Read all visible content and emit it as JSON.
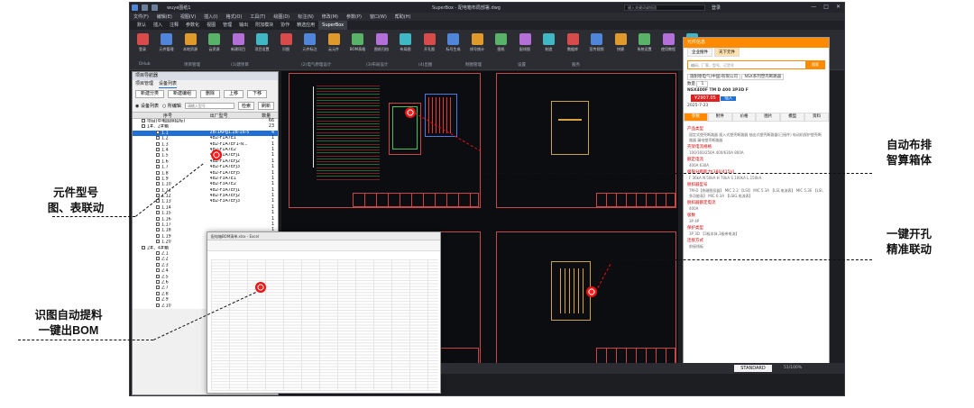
{
  "window": {
    "app_title": "SuperBox - 配电箱布局部署.dwg",
    "doc_name": "wuye图纸1",
    "search_placeholder": "键入关键词或短语",
    "user": "登录",
    "min": "—",
    "max": "□",
    "close": "✕"
  },
  "menu": [
    "文件(F)",
    "编辑(E)",
    "视图(V)",
    "插入(I)",
    "格式(O)",
    "工具(T)",
    "绘图(D)",
    "标注(N)",
    "修改(M)",
    "参数(P)",
    "窗口(W)",
    "帮助(H)"
  ],
  "tabs": [
    "默认",
    "插入",
    "注释",
    "参数化",
    "视图",
    "管理",
    "输出",
    "附加模块",
    "协作",
    "精选应用",
    "SuperBox"
  ],
  "active_tab": "SuperBox",
  "ribbon": {
    "buttons": [
      "登录",
      "元件管理",
      "本地资源",
      "云资源",
      "新建项目",
      "项目设置",
      "识图",
      "元件标注",
      "云元件",
      "BOM表格",
      "图纸归档",
      "布局图",
      "开孔图",
      "标号生成",
      "线号统计",
      "图纸",
      "配线图",
      "制造",
      "数据库",
      "宣传视频",
      "快捷",
      "系统设置",
      "使用教程",
      "在线客服"
    ],
    "groups": [
      "DHub",
      "项目管理",
      "(1)建项目",
      "(2)电气原理设计",
      "(3)布局设计",
      "(4)出图",
      "制图管理",
      "设置",
      "服务"
    ]
  },
  "left_panel": {
    "title": "项目导航器",
    "tabs": [
      "项目管理",
      "设备列表"
    ],
    "buttons": [
      "新建分类",
      "新建编组",
      "删除",
      "上移",
      "下移"
    ],
    "radio_all": "设备列表",
    "radio_edit": "所编辑",
    "filter_placeholder": "请输入型号",
    "filter_btn1": "检索",
    "filter_btn2": "刷新",
    "columns": [
      "序号",
      "出厂型号",
      "数量"
    ],
    "group_root": "项目(中电国际招标)",
    "group_root_qty": "66",
    "group1": "1#、2#箱",
    "group1_qty": "23",
    "group2": "2#、4#箱",
    "rows1": [
      {
        "id": "1.1",
        "model": "2B-1APg1.2B-16-5",
        "qty": "4"
      },
      {
        "id": "1.2",
        "model": "4B2-F1A7E1",
        "qty": "1"
      },
      {
        "id": "1.3",
        "model": "4B2-F1A7EF1-N...",
        "qty": "1"
      },
      {
        "id": "1.4",
        "model": "4B2-F1A7E2",
        "qty": "1"
      },
      {
        "id": "1.5",
        "model": "4B2-F1A7EFJ1",
        "qty": "1"
      },
      {
        "id": "1.6",
        "model": "4B2-F1A7EFJ2",
        "qty": "1"
      },
      {
        "id": "1.7",
        "model": "4B2-F1A7EFJ3",
        "qty": "1"
      },
      {
        "id": "1.8",
        "model": "4B2-F1A7EFJ5",
        "qty": "1"
      },
      {
        "id": "1.9",
        "model": "4B2-F3A7E1",
        "qty": "1"
      },
      {
        "id": "1.10",
        "model": "4B2-F3A7E2",
        "qty": "1"
      },
      {
        "id": "1.11",
        "model": "4B2-F3A7EFJ1",
        "qty": "1"
      },
      {
        "id": "1.12",
        "model": "4B2-F3A7EFJ2",
        "qty": "1"
      },
      {
        "id": "1.13",
        "model": "4B2-F3A7EFJ3",
        "qty": "1"
      },
      {
        "id": "1.14",
        "model": "",
        "qty": "1"
      },
      {
        "id": "1.15",
        "model": "",
        "qty": "1"
      },
      {
        "id": "1.16",
        "model": "",
        "qty": "1"
      },
      {
        "id": "1.17",
        "model": "",
        "qty": "1"
      },
      {
        "id": "1.18",
        "model": "",
        "qty": "1"
      },
      {
        "id": "1.19",
        "model": "",
        "qty": "1"
      },
      {
        "id": "1.20",
        "model": "",
        "qty": "1"
      }
    ],
    "rows2": [
      "2.1",
      "2.2",
      "2.3",
      "2.4",
      "2.5",
      "2.6",
      "2.7",
      "2.8",
      "2.9",
      "2.10"
    ]
  },
  "excel": {
    "title": "配电箱BOM清单.xlsx - Excel"
  },
  "web_panel": {
    "title": "元件信息",
    "tabs": [
      "企业搜件",
      "天下元件"
    ],
    "search_placeholder": "编码、厂家、型号、订货号",
    "search_btn": "搜索",
    "brand_line": "施耐德电气(中国)有限公司",
    "series_line": "NSX系列塑壳断路器",
    "qty_label": "数量",
    "qty": "1",
    "part_title": "NSX400F TM D 400 3P3D F",
    "price": "¥2907.05",
    "add_btn": "插入",
    "date": "2025-7-23",
    "detail_tabs": [
      "参数",
      "附件",
      "价格",
      "图片",
      "模型",
      "资料"
    ],
    "sections": [
      {
        "h": "产品类型",
        "opts": "固定式塑壳断路器 插入式塑壳断路器 抽出式塑壳断路器(已接件) 电动机保护塑壳断路器 漏电塑壳断路器"
      },
      {
        "h": "壳架电流规格",
        "opts": "100/160/250A 400/630A 800A"
      },
      {
        "h": "额定电流",
        "opts": "400A 630A"
      },
      {
        "h": "极限分断能力(380/415V)",
        "opts": "F 36kA N 50kA H 70kA S 100kA L 150kA"
      },
      {
        "h": "脱扣器型号",
        "opts": "TM-D【热磁脱扣器】 MIC 2.2 【LSI】 MIC 5.3A 【LSI,电流表】 MIC 5.3E 【LSI,多功能表】 MIC 6.3A 【LSIG,电流表】"
      },
      {
        "h": "脱扣器额定电流",
        "opts": "400A"
      },
      {
        "h": "极数",
        "opts": "3P 4P"
      },
      {
        "h": "保护类型",
        "opts": "3P 3D 【3极本体,3极带电流】"
      },
      {
        "h": "连接方式",
        "opts": "前接线板"
      }
    ]
  },
  "status": {
    "standard": "STANDARD",
    "zoom": "51/100%"
  },
  "callouts": {
    "c1_line1": "元件型号",
    "c1_line2": "图、表联动",
    "c2_line1": "识图自动提料",
    "c2_line2": "一键出BOM",
    "c3_line1": "自动布排",
    "c3_line2": "智算箱体",
    "c4_line1": "一键开孔",
    "c4_line2": "精准联动"
  }
}
